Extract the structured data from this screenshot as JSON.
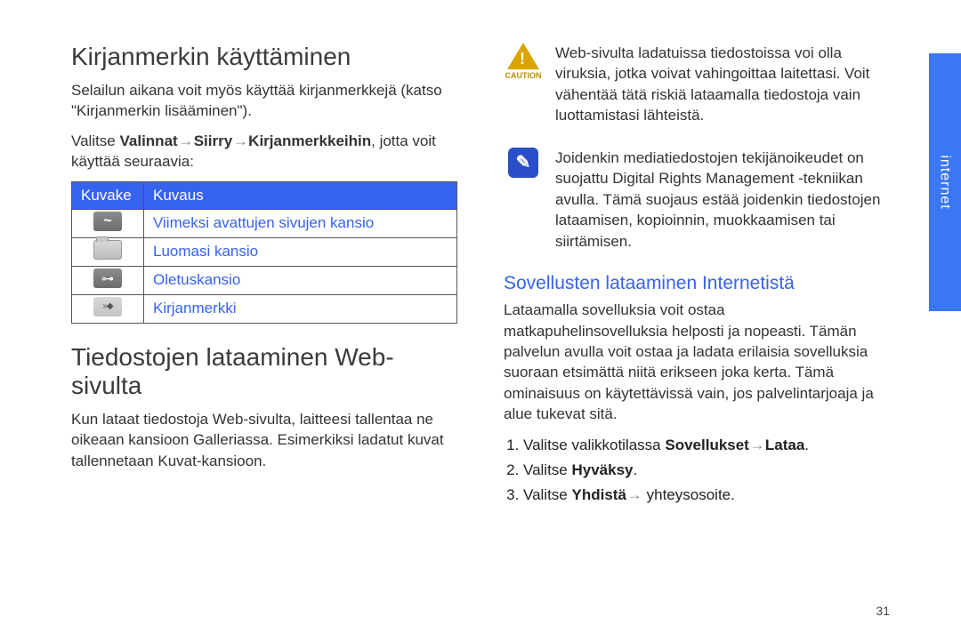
{
  "side_tab": "internet",
  "page_number": "31",
  "left": {
    "heading1": "Kirjanmerkin käyttäminen",
    "para1": "Selailun aikana voit myös käyttää kirjanmerkkejä (katso \"Kirjanmerkin lisääminen\").",
    "para2_prefix": "Valitse ",
    "para2_b1": "Valinnat",
    "para2_b2": "Siirry",
    "para2_b3": "Kirjanmerkkeihin",
    "para2_suffix": ", jotta voit käyttää seuraavia:",
    "table": {
      "h1": "Kuvake",
      "h2": "Kuvaus",
      "rows": [
        {
          "icon": "tilde",
          "text": "Viimeksi avattujen sivujen kansio"
        },
        {
          "icon": "folder",
          "text": "Luomasi kansio"
        },
        {
          "icon": "key",
          "text": "Oletuskansio"
        },
        {
          "icon": "bookmark",
          "text": "Kirjanmerkki"
        }
      ]
    },
    "heading2": "Tiedostojen lataaminen Web-sivulta",
    "para3": "Kun lataat tiedostoja Web-sivulta, laitteesi tallentaa ne oikeaan kansioon Galleriassa. Esimerkiksi ladatut kuvat tallennetaan Kuvat-kansioon."
  },
  "right": {
    "caution_label": "CAUTION",
    "caution_text": "Web-sivulta ladatuissa tiedostoissa voi olla viruksia, jotka voivat vahingoittaa laitettasi. Voit vähentää tätä riskiä lataamalla tiedostoja vain luottamistasi lähteistä.",
    "note_text": "Joidenkin mediatiedostojen tekijänoikeudet on suojattu Digital Rights Management -tekniikan avulla. Tämä suojaus estää joidenkin tiedostojen lataamisen, kopioinnin, muokkaamisen tai siirtämisen.",
    "heading3": "Sovellusten lataaminen Internetistä",
    "para4": "Lataamalla sovelluksia voit ostaa matkapuhelinsovelluksia helposti ja nopeasti. Tämän palvelun avulla voit ostaa ja ladata erilaisia sovelluksia suoraan etsimättä niitä erikseen joka kerta. Tämä ominaisuus on käytettävissä vain, jos palvelintarjoaja ja alue tukevat sitä.",
    "step1_prefix": "Valitse valikkotilassa ",
    "step1_b1": "Sovellukset",
    "step1_b2": "Lataa",
    "step1_suffix": ".",
    "step2_prefix": "Valitse ",
    "step2_b": "Hyväksy",
    "step2_suffix": ".",
    "step3_prefix": "Valitse ",
    "step3_b": "Yhdistä",
    "step3_suffix": " yhteysosoite."
  }
}
